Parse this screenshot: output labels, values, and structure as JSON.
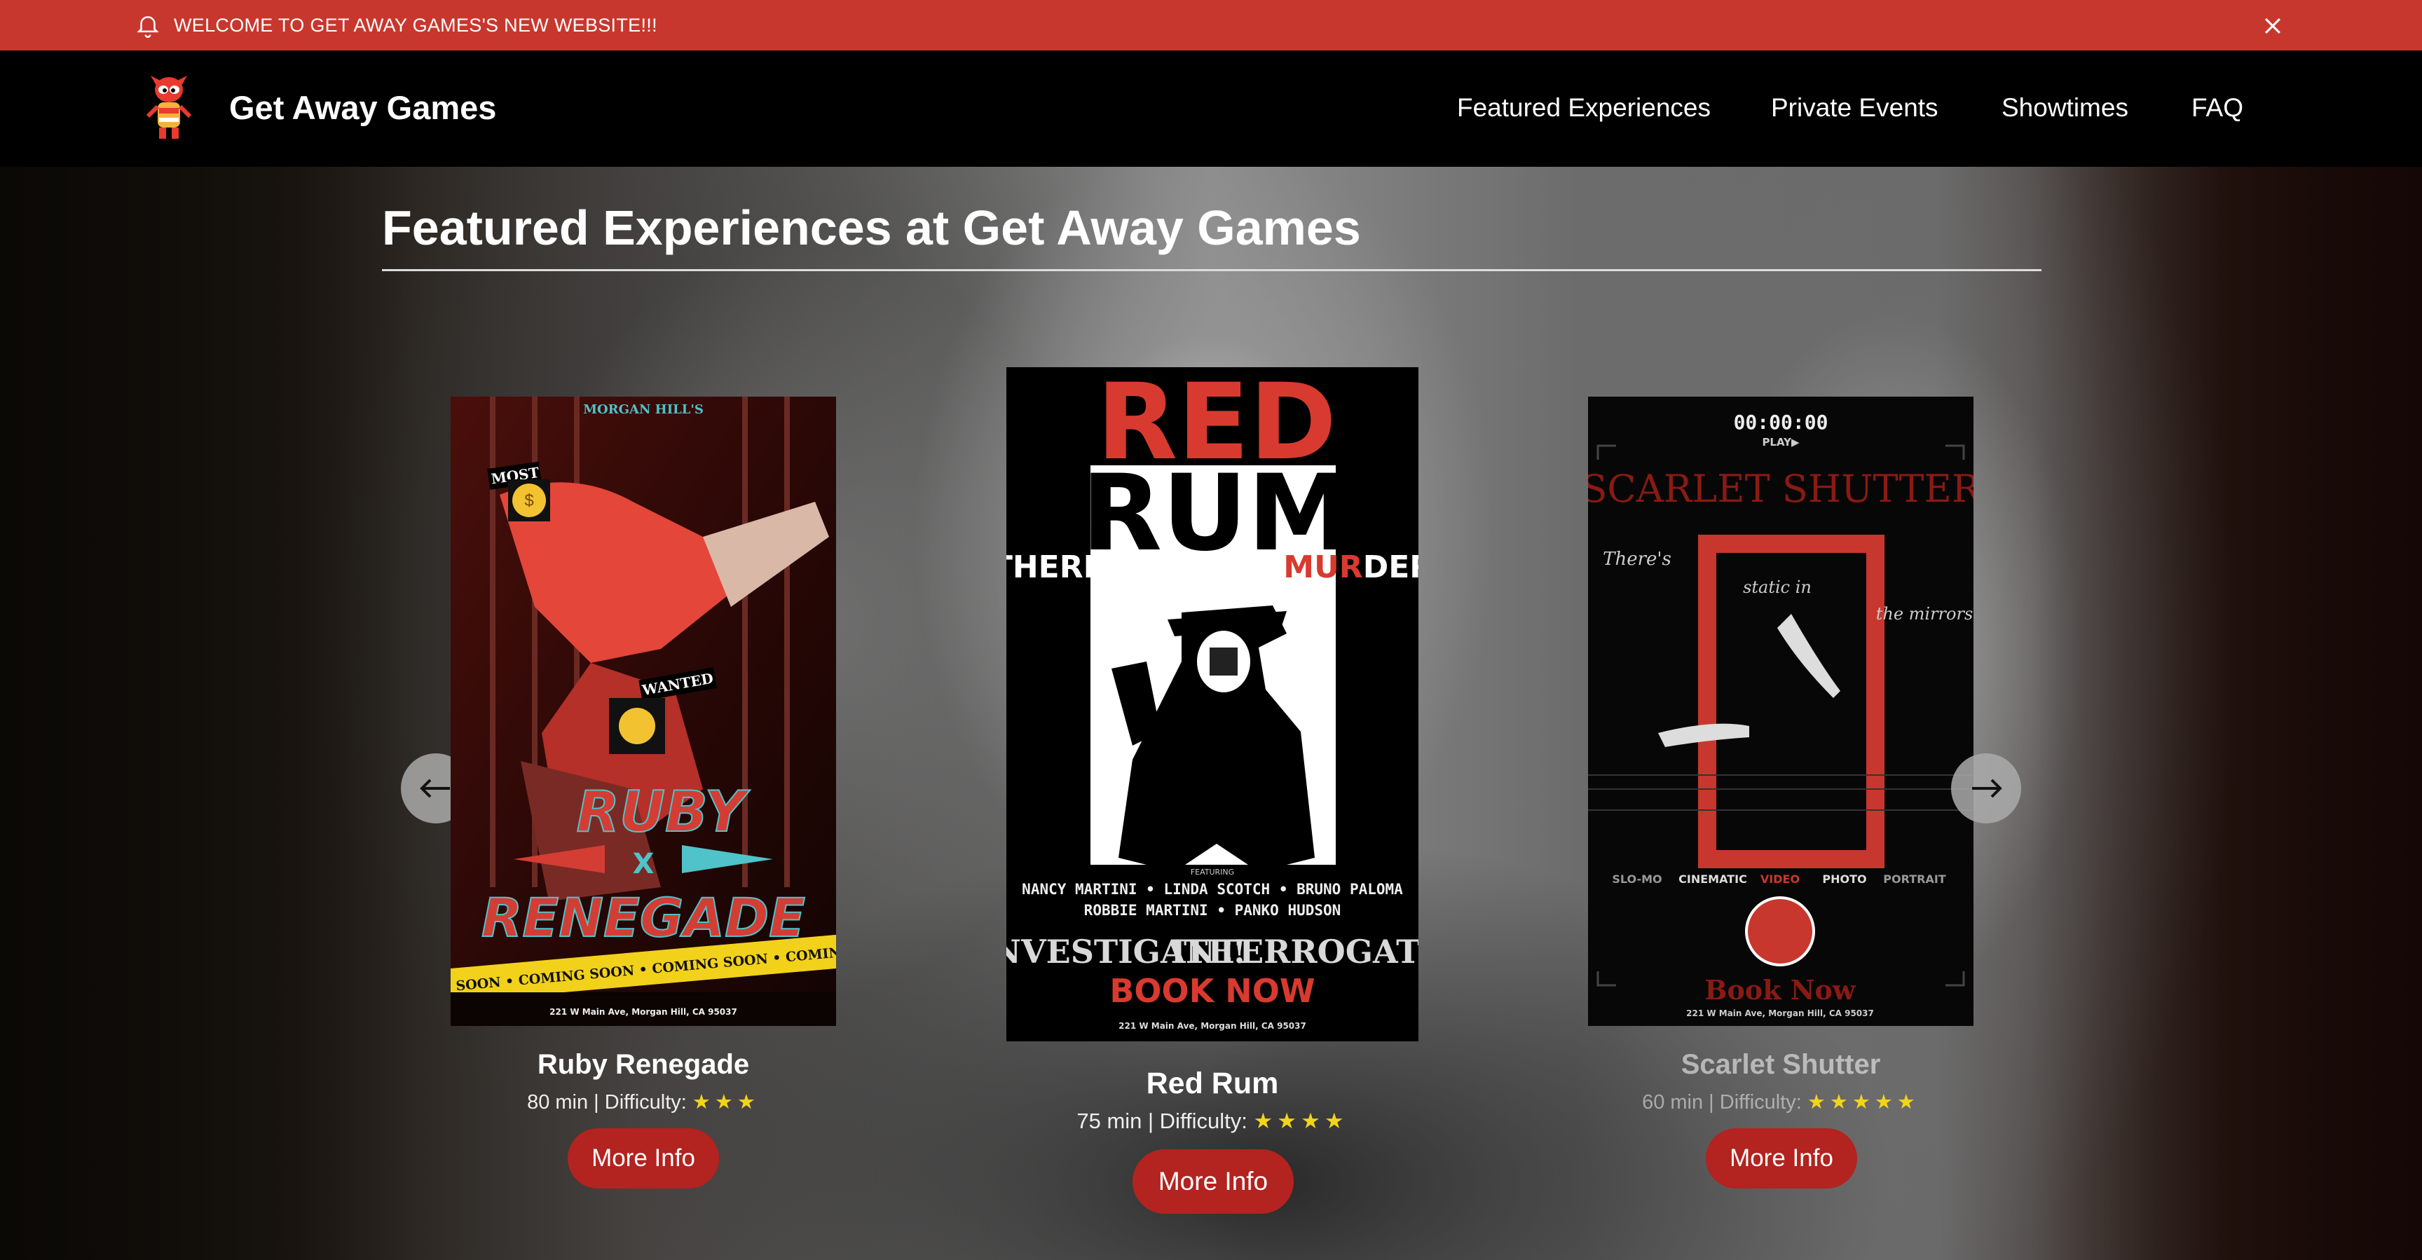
{
  "announcement": {
    "text": "WELCOME TO GET AWAY GAMES'S NEW WEBSITE!!!",
    "icon": "bell-icon",
    "close_icon": "close-icon"
  },
  "nav": {
    "brand": "Get Away Games",
    "links": [
      "Featured Experiences",
      "Private Events",
      "Showtimes",
      "FAQ"
    ]
  },
  "main": {
    "title": "Featured Experiences at Get Away Games",
    "cards": [
      {
        "name": "Ruby Renegade",
        "meta": "80 min | Difficulty:",
        "stars": "★★★",
        "difficulty": 3,
        "button": "More Info",
        "poster": {
          "top": "MORGAN HILL'S",
          "line1": "MOST",
          "line2": "WANTED",
          "title1": "RUBY",
          "x": "X",
          "title2": "RENEGADE",
          "tape": "COMING SOON • COMING SOON • COMING SOON • COMING SOON",
          "address": "221 W Main Ave, Morgan Hill, CA 95037"
        }
      },
      {
        "name": "Red Rum",
        "meta": "75 min | Difficulty:",
        "stars": "★★★★",
        "difficulty": 4,
        "button": "More Info",
        "poster": {
          "title1": "RED",
          "title2": "RUM",
          "tag_pre": "THERE'S BEEN A ",
          "tag_red": "MUR",
          "tag_post": "DER",
          "featuring": "FEATURING",
          "cast1": "NANCY MARTINI • LINDA SCOTCH • BRUNO PALOMA",
          "cast2": "ROBBIE MARTINI • PANKO HUDSON",
          "cta1": "INVESTIGATE!",
          "cta2": "INTERROGATE!",
          "book": "BOOK NOW",
          "address": "221 W Main Ave, Morgan Hill, CA 95037"
        }
      },
      {
        "name": "Scarlet Shutter",
        "meta": "60 min | Difficulty:",
        "stars": "★★★★★",
        "difficulty": 5,
        "button": "More Info",
        "poster": {
          "timer": "00:00:00",
          "play": "PLAY▶",
          "title": "SCARLET SHUTTER",
          "t1": "There's",
          "t2": "static in",
          "t3": "the mirrors",
          "modes": [
            "SLO-MO",
            "CINEMATIC",
            "VIDEO",
            "PHOTO",
            "PORTRAIT"
          ],
          "book": "Book Now",
          "address": "221 W Main Ave, Morgan Hill, CA 95037"
        }
      }
    ]
  },
  "carousel": {
    "prev_icon": "arrow-left-icon",
    "next_icon": "arrow-right-icon"
  },
  "colors": {
    "accent_red": "#c8372d",
    "button_red": "#b3231f",
    "star_yellow": "#f2d51b",
    "nav_bg": "#000000"
  }
}
